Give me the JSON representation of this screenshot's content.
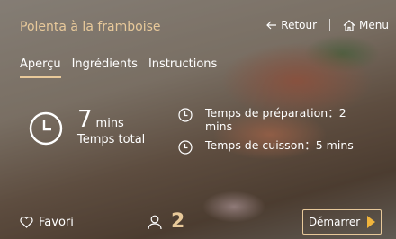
{
  "header": {
    "title": "Polenta à la framboise",
    "back_label": "Retour",
    "menu_label": "Menu"
  },
  "tabs": [
    {
      "label": "Aperçu",
      "active": true
    },
    {
      "label": "Ingrédients",
      "active": false
    },
    {
      "label": "Instructions",
      "active": false
    }
  ],
  "overview": {
    "total_time_value": "7",
    "total_time_unit": "mins",
    "total_time_label": "Temps total",
    "prep_time": "Temps de préparation：2 mins",
    "cook_time": "Temps de cuisson：5 mins"
  },
  "footer": {
    "favorite_label": "Favori",
    "servings": "2",
    "start_label": "Démarrer"
  },
  "colors": {
    "accent": "#e8c99a",
    "play": "#f0b43c"
  },
  "icons": [
    "arrow-left-icon",
    "home-icon",
    "clock-icon",
    "heart-icon",
    "person-icon",
    "play-icon"
  ]
}
